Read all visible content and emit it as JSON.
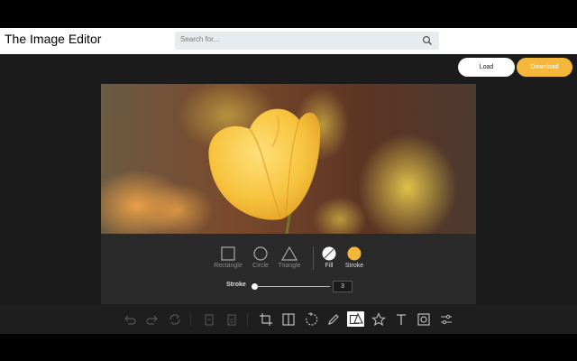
{
  "app": {
    "title": "The Image Editor"
  },
  "search": {
    "placeholder": "Search for..."
  },
  "actions": {
    "load_label": "Load",
    "download_label": "Download"
  },
  "shape_panel": {
    "shapes": [
      {
        "label": "Rectangle",
        "icon": "rectangle-icon"
      },
      {
        "label": "Circle",
        "icon": "circle-icon"
      },
      {
        "label": "Triangle",
        "icon": "triangle-icon"
      }
    ],
    "style": [
      {
        "label": "Fill",
        "icon": "no-fill-icon"
      },
      {
        "label": "Stroke",
        "icon": "stroke-color-icon",
        "color": "#f4b73a"
      }
    ],
    "stroke": {
      "label": "Stroke",
      "value": "3"
    }
  },
  "toolbar": {
    "tools": [
      {
        "name": "undo-icon",
        "enabled": false
      },
      {
        "name": "redo-icon",
        "enabled": false
      },
      {
        "name": "reset-icon",
        "enabled": false
      },
      {
        "name": "delete-icon",
        "enabled": false
      },
      {
        "name": "delete-all-icon",
        "enabled": false
      },
      {
        "name": "crop-icon",
        "enabled": true
      },
      {
        "name": "flip-icon",
        "enabled": true
      },
      {
        "name": "rotate-icon",
        "enabled": true
      },
      {
        "name": "draw-icon",
        "enabled": true
      },
      {
        "name": "shape-icon",
        "enabled": true,
        "active": true
      },
      {
        "name": "icon-icon",
        "enabled": true
      },
      {
        "name": "text-icon",
        "enabled": true
      },
      {
        "name": "mask-icon",
        "enabled": true
      },
      {
        "name": "filter-icon",
        "enabled": true
      }
    ]
  },
  "colors": {
    "accent": "#f4b73a",
    "background": "#1b1b1b",
    "panel": "#2a2a2a"
  }
}
